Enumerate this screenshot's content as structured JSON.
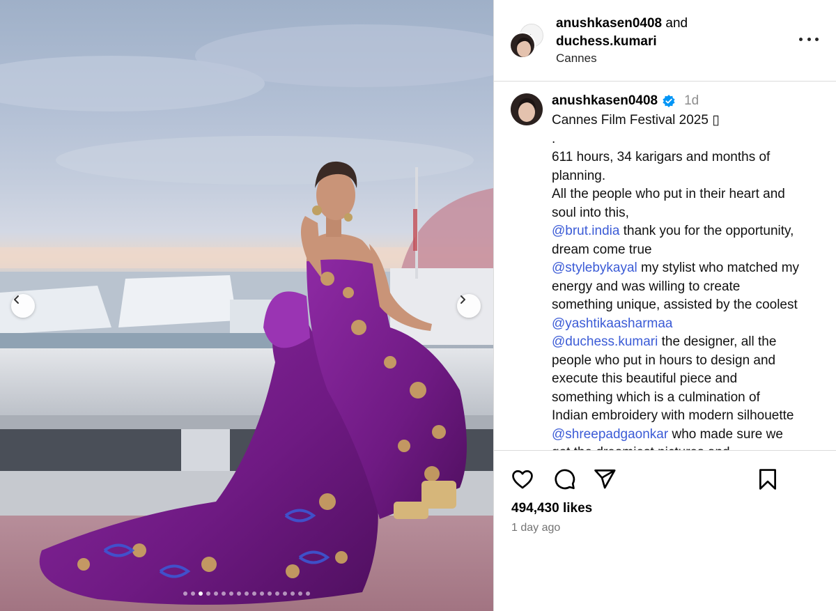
{
  "media": {
    "prev_icon": "chevron-left-icon",
    "next_icon": "chevron-right-icon",
    "slide_count": 17,
    "active_slide": 3
  },
  "header": {
    "user_primary": "anushkasen0408",
    "joiner": "and",
    "user_secondary": "duchess.kumari",
    "location": "Cannes",
    "more_icon": "more-horizontal-icon"
  },
  "post": {
    "username": "anushkasen0408",
    "verified_icon": "verified-badge-icon",
    "time": "1d",
    "caption_lines": [
      {
        "text": "Cannes Film Festival 2025 ▯"
      },
      {
        "text": "."
      },
      {
        "text": "611 hours, 34 karigars and months of"
      },
      {
        "text": "planning."
      },
      {
        "text": "All the people who put in their heart and"
      },
      {
        "text": "soul into this,"
      },
      {
        "mention": "@brut.india",
        "text": " thank you for the opportunity,"
      },
      {
        "text": "dream come true"
      },
      {
        "mention": "@stylebykayal",
        "text": " my stylist who matched my"
      },
      {
        "text": "energy and was willing to create"
      },
      {
        "text": "something unique, assisted by the coolest"
      },
      {
        "mention": "@yashtikaasharmaa",
        "text": ""
      },
      {
        "mention": "@duchess.kumari",
        "text": " the designer, all the"
      },
      {
        "text": "people who put in hours to design and"
      },
      {
        "text": "execute this beautiful piece and"
      },
      {
        "text": "something which is a culmination of"
      },
      {
        "text": "Indian embroidery with modern silhouette"
      },
      {
        "mention": "@shreepadgaonkar",
        "text": " who made sure we"
      },
      {
        "text": "got the dreamiest pictures and"
      }
    ]
  },
  "actions": {
    "like_icon": "heart-icon",
    "comment_icon": "comment-icon",
    "share_icon": "send-icon",
    "save_icon": "bookmark-icon",
    "likes": "494,430 likes",
    "time_ago": "1 day ago"
  },
  "colors": {
    "mention": "#3b5bd6",
    "verified": "#0095f6",
    "gown": "#7a1f8c",
    "divider": "#dbdbdb"
  }
}
